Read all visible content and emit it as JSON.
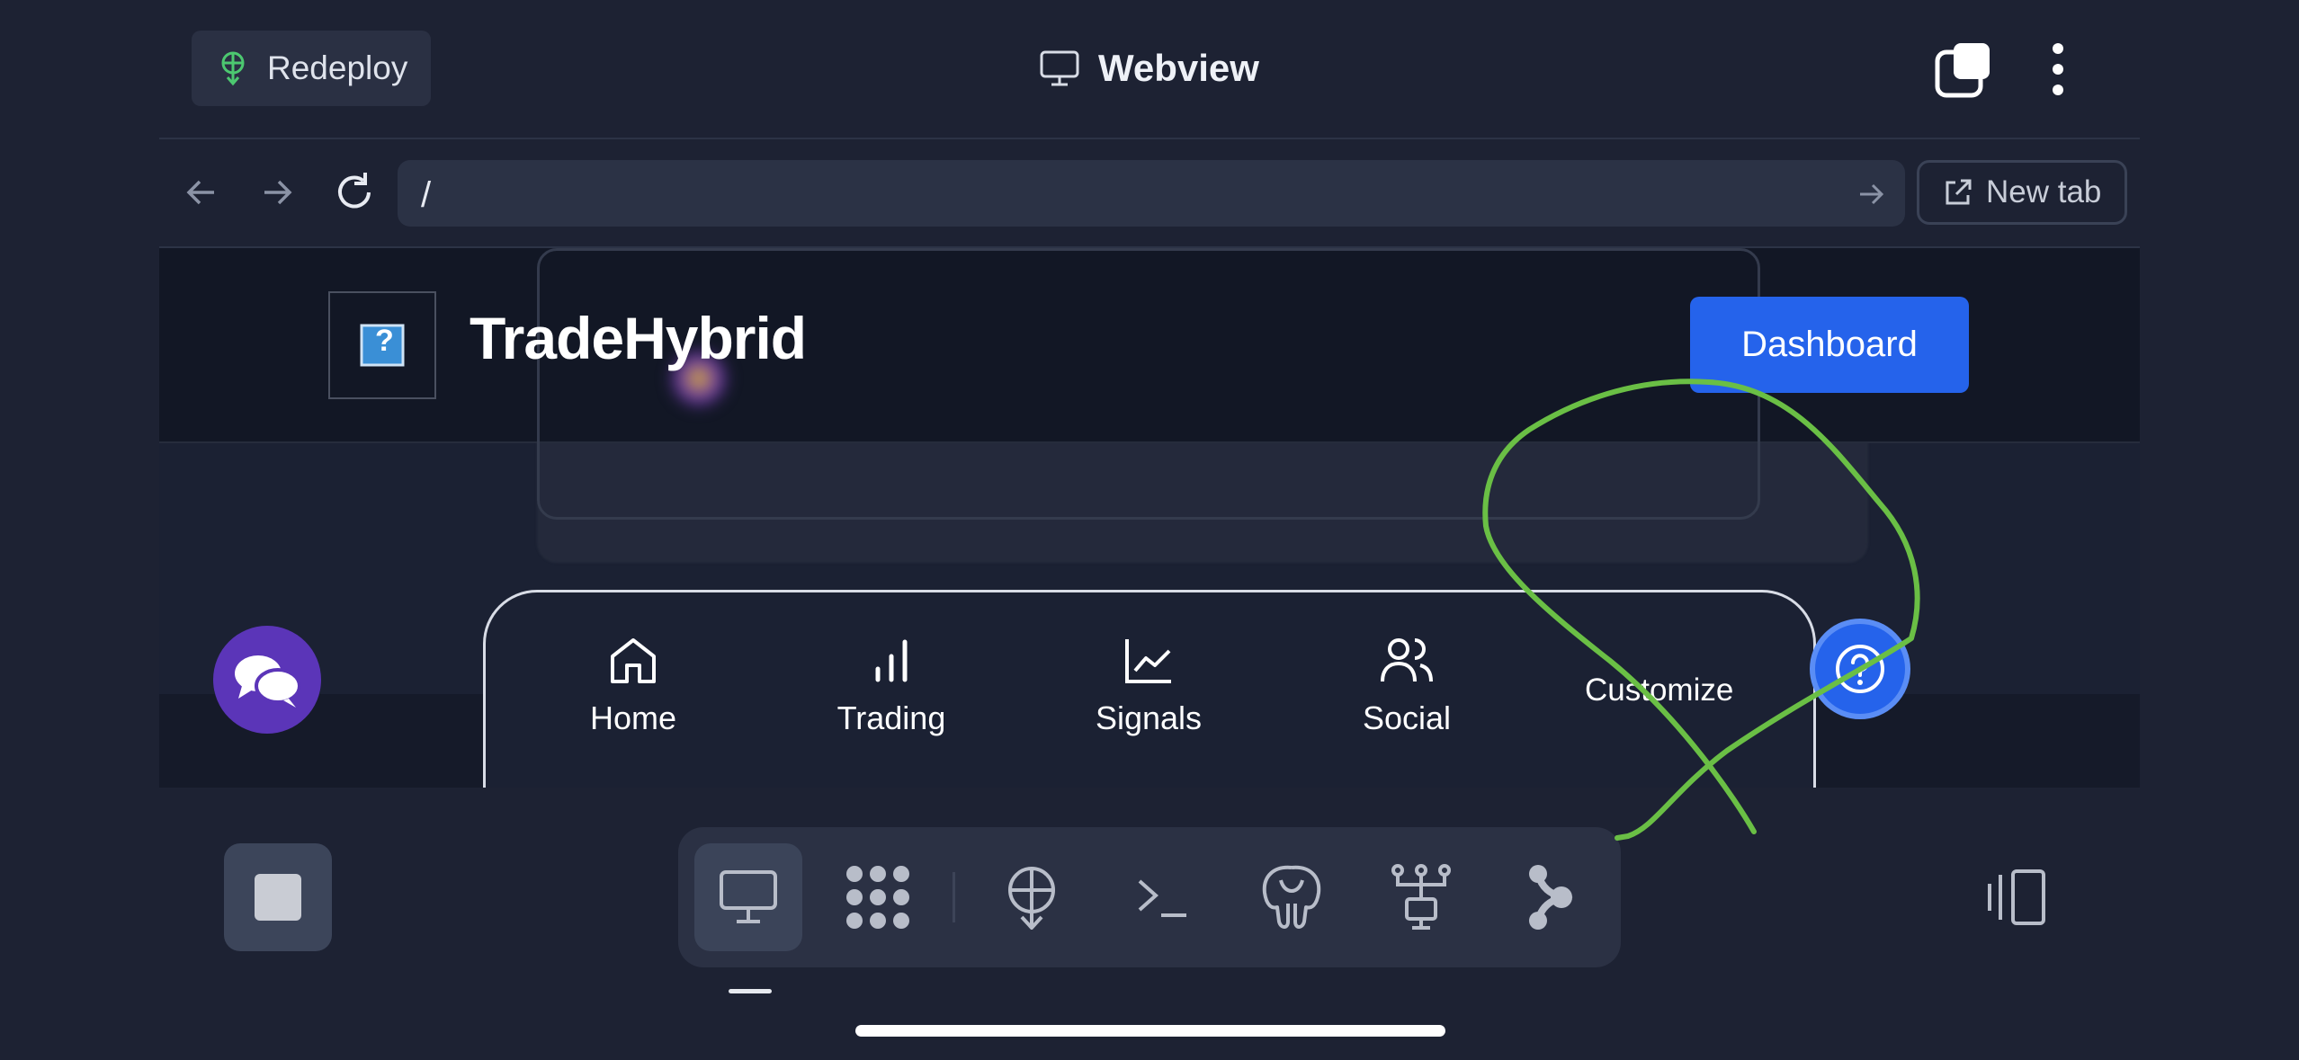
{
  "topbar": {
    "redeploy_label": "Redeploy",
    "title": "Webview"
  },
  "addressbar": {
    "url": "/",
    "new_tab_label": "New tab"
  },
  "webview": {
    "brand": "TradeHybrid",
    "logo_glyph": "?",
    "dashboard_label": "Dashboard",
    "nav": [
      {
        "label": "Home",
        "icon": "home-icon"
      },
      {
        "label": "Trading",
        "icon": "bar-chart-icon"
      },
      {
        "label": "Signals",
        "icon": "line-chart-icon"
      },
      {
        "label": "Social",
        "icon": "users-icon"
      }
    ],
    "customize_label": "Customize"
  },
  "dock": {
    "items": [
      "monitor-icon",
      "dots-grid-icon",
      "deploy-icon",
      "terminal-icon",
      "postgres-icon",
      "network-icon",
      "connector-icon"
    ]
  },
  "colors": {
    "background": "#1d2233",
    "accent": "#2563eb",
    "chat_fab": "#5b35b8",
    "annotation": "#6abf45"
  }
}
